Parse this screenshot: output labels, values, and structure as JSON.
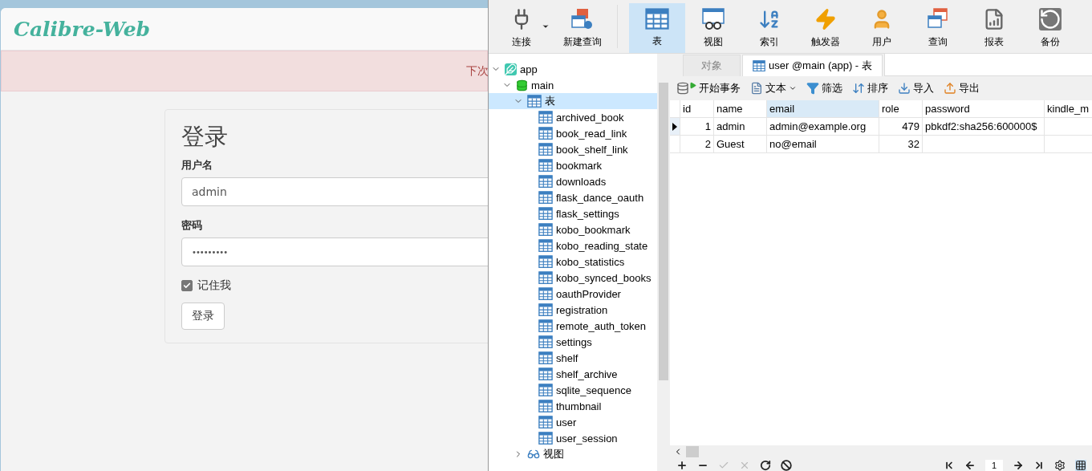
{
  "browser": {
    "logo": "Calibre-Web",
    "alert_text": "下次",
    "login": {
      "title": "登录",
      "fields": [
        {
          "label": "用户名",
          "value": "admin",
          "kind": "text"
        },
        {
          "label": "密码",
          "value": "•••••••••",
          "kind": "password"
        }
      ],
      "remember": {
        "label": "记住我",
        "checked": true
      },
      "submit": "登录"
    }
  },
  "navicat": {
    "toolbar": [
      {
        "label": "连接",
        "selected": false,
        "has_menu": true
      },
      {
        "label": "新建查询",
        "selected": false,
        "has_menu": false
      },
      {
        "label": "表",
        "selected": true,
        "has_menu": false
      },
      {
        "label": "视图",
        "selected": false,
        "has_menu": false
      },
      {
        "label": "索引",
        "selected": false,
        "has_menu": false
      },
      {
        "label": "触发器",
        "selected": false,
        "has_menu": false
      },
      {
        "label": "用户",
        "selected": false,
        "has_menu": false
      },
      {
        "label": "查询",
        "selected": false,
        "has_menu": false
      },
      {
        "label": "报表",
        "selected": false,
        "has_menu": false
      },
      {
        "label": "备份",
        "selected": false,
        "has_menu": false
      }
    ],
    "tree": [
      {
        "label": "app",
        "kind": "connection",
        "selected": false,
        "expanded": true,
        "children": [
          {
            "label": "main",
            "kind": "database",
            "selected": false,
            "expanded": true,
            "children": [
              {
                "label": "表",
                "kind": "tables",
                "selected": true,
                "expanded": true,
                "children": [
                  {
                    "label": "archived_book",
                    "kind": "table",
                    "selected": false
                  },
                  {
                    "label": "book_read_link",
                    "kind": "table",
                    "selected": false
                  },
                  {
                    "label": "book_shelf_link",
                    "kind": "table",
                    "selected": false
                  },
                  {
                    "label": "bookmark",
                    "kind": "table",
                    "selected": false
                  },
                  {
                    "label": "downloads",
                    "kind": "table",
                    "selected": false
                  },
                  {
                    "label": "flask_dance_oauth",
                    "kind": "table",
                    "selected": false
                  },
                  {
                    "label": "flask_settings",
                    "kind": "table",
                    "selected": false
                  },
                  {
                    "label": "kobo_bookmark",
                    "kind": "table",
                    "selected": false
                  },
                  {
                    "label": "kobo_reading_state",
                    "kind": "table",
                    "selected": false
                  },
                  {
                    "label": "kobo_statistics",
                    "kind": "table",
                    "selected": false
                  },
                  {
                    "label": "kobo_synced_books",
                    "kind": "table",
                    "selected": false
                  },
                  {
                    "label": "oauthProvider",
                    "kind": "table",
                    "selected": false
                  },
                  {
                    "label": "registration",
                    "kind": "table",
                    "selected": false
                  },
                  {
                    "label": "remote_auth_token",
                    "kind": "table",
                    "selected": false
                  },
                  {
                    "label": "settings",
                    "kind": "table",
                    "selected": false
                  },
                  {
                    "label": "shelf",
                    "kind": "table",
                    "selected": false
                  },
                  {
                    "label": "shelf_archive",
                    "kind": "table",
                    "selected": false
                  },
                  {
                    "label": "sqlite_sequence",
                    "kind": "table",
                    "selected": false
                  },
                  {
                    "label": "thumbnail",
                    "kind": "table",
                    "selected": false
                  },
                  {
                    "label": "user",
                    "kind": "table",
                    "selected": false
                  },
                  {
                    "label": "user_session",
                    "kind": "table",
                    "selected": false
                  }
                ]
              },
              {
                "label": "视图",
                "kind": "views",
                "selected": false,
                "expanded": false
              }
            ]
          }
        ]
      }
    ],
    "tabs": [
      {
        "label": "对象",
        "selected": false
      },
      {
        "label": "user @main (app) - 表",
        "selected": true
      }
    ],
    "actions": [
      {
        "label": "开始事务",
        "has_menu": false
      },
      {
        "label": "文本",
        "has_menu": true
      },
      {
        "label": "筛选",
        "has_menu": false
      },
      {
        "label": "排序",
        "has_menu": false
      },
      {
        "label": "导入",
        "has_menu": false
      },
      {
        "label": "导出",
        "has_menu": false
      }
    ],
    "grid": {
      "columns": [
        {
          "label": "id",
          "selected": false
        },
        {
          "label": "name",
          "selected": false
        },
        {
          "label": "email",
          "selected": true
        },
        {
          "label": "role",
          "selected": false
        },
        {
          "label": "password",
          "selected": false
        },
        {
          "label": "kindle_m",
          "selected": false
        }
      ],
      "rows": [
        {
          "selected": true,
          "cells": [
            "1",
            "admin",
            "admin@example.org",
            "479",
            "pbkdf2:sha256:600000$"
          ]
        },
        {
          "selected": false,
          "cells": [
            "2",
            "Guest",
            "no@email",
            "32"
          ]
        }
      ]
    },
    "pager": {
      "page": "1"
    }
  }
}
